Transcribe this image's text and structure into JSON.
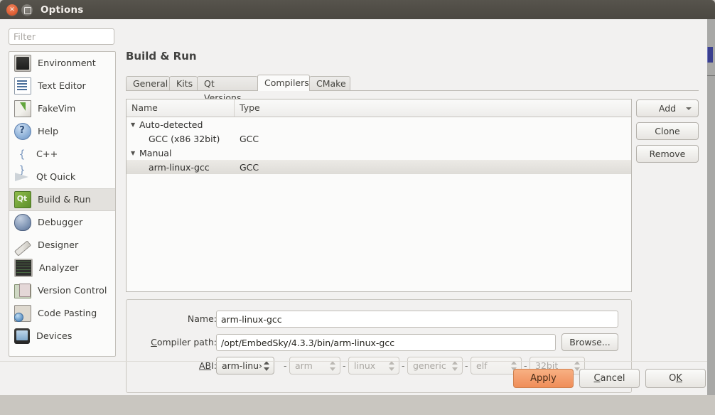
{
  "window": {
    "title": "Options",
    "close_icon": "close-icon",
    "maximize_icon": "maximize-icon"
  },
  "sidebar": {
    "filter": {
      "value": "",
      "placeholder": "Filter"
    },
    "items": [
      {
        "label": "Environment",
        "icon": "environment-icon",
        "selected": false
      },
      {
        "label": "Text Editor",
        "icon": "text-editor-icon",
        "selected": false
      },
      {
        "label": "FakeVim",
        "icon": "fakevim-icon",
        "selected": false
      },
      {
        "label": "Help",
        "icon": "help-icon",
        "selected": false
      },
      {
        "label": "C++",
        "icon": "cpp-icon",
        "selected": false
      },
      {
        "label": "Qt Quick",
        "icon": "qt-quick-icon",
        "selected": false
      },
      {
        "label": "Build & Run",
        "icon": "build-and-run-icon",
        "selected": true
      },
      {
        "label": "Debugger",
        "icon": "debugger-icon",
        "selected": false
      },
      {
        "label": "Designer",
        "icon": "designer-icon",
        "selected": false
      },
      {
        "label": "Analyzer",
        "icon": "analyzer-icon",
        "selected": false
      },
      {
        "label": "Version Control",
        "icon": "version-control-icon",
        "selected": false
      },
      {
        "label": "Code Pasting",
        "icon": "code-pasting-icon",
        "selected": false
      },
      {
        "label": "Devices",
        "icon": "devices-icon",
        "selected": false
      }
    ]
  },
  "main": {
    "page_title": "Build & Run",
    "tabs": [
      {
        "label": "General",
        "active": false
      },
      {
        "label": "Kits",
        "active": false
      },
      {
        "label": "Qt Versions",
        "active": false
      },
      {
        "label": "Compilers",
        "active": true
      },
      {
        "label": "CMake",
        "active": false
      }
    ],
    "compiler_list": {
      "columns": [
        "Name",
        "Type"
      ],
      "rows": [
        {
          "name": "Auto-detected",
          "type": "",
          "kind": "group",
          "expanded": true,
          "selected": false
        },
        {
          "name": "GCC (x86 32bit)",
          "type": "GCC",
          "kind": "item",
          "expanded": false,
          "selected": false
        },
        {
          "name": "Manual",
          "type": "",
          "kind": "group",
          "expanded": true,
          "selected": false
        },
        {
          "name": "arm-linux-gcc",
          "type": "GCC",
          "kind": "item",
          "expanded": false,
          "selected": true
        }
      ]
    },
    "side_buttons": [
      {
        "label": "Add",
        "has_dropdown": true
      },
      {
        "label": "Clone",
        "has_dropdown": false
      },
      {
        "label": "Remove",
        "has_dropdown": false
      }
    ],
    "details": {
      "name_label": "Name:",
      "name_value": "arm-linux-gcc",
      "path_label_pre": "C",
      "path_label_post": "ompiler path:",
      "path_value": "/opt/EmbedSky/4.3.3/bin/arm-linux-gcc",
      "browse_label": "Browse...",
      "abi_label_pre": "A",
      "abi_label_mid": "B",
      "abi_label_post": "I:",
      "abi_combo": "arm-linu›",
      "abi_parts": [
        {
          "value": "arm",
          "disabled": true
        },
        {
          "value": "linux",
          "disabled": true
        },
        {
          "value": "generic",
          "disabled": true
        },
        {
          "value": "elf",
          "disabled": true
        },
        {
          "value": "32bit",
          "disabled": true
        }
      ],
      "separator": "-"
    }
  },
  "footer": {
    "apply": "Apply",
    "cancel_pre": "C",
    "cancel_post": "ancel",
    "ok_pre": "O",
    "ok_post": "K"
  },
  "colors": {
    "accent_apply": "#f4a070",
    "titlebar": "#514e47",
    "dialog_bg": "#f2f1f0",
    "selection": "#e3e1dd"
  }
}
